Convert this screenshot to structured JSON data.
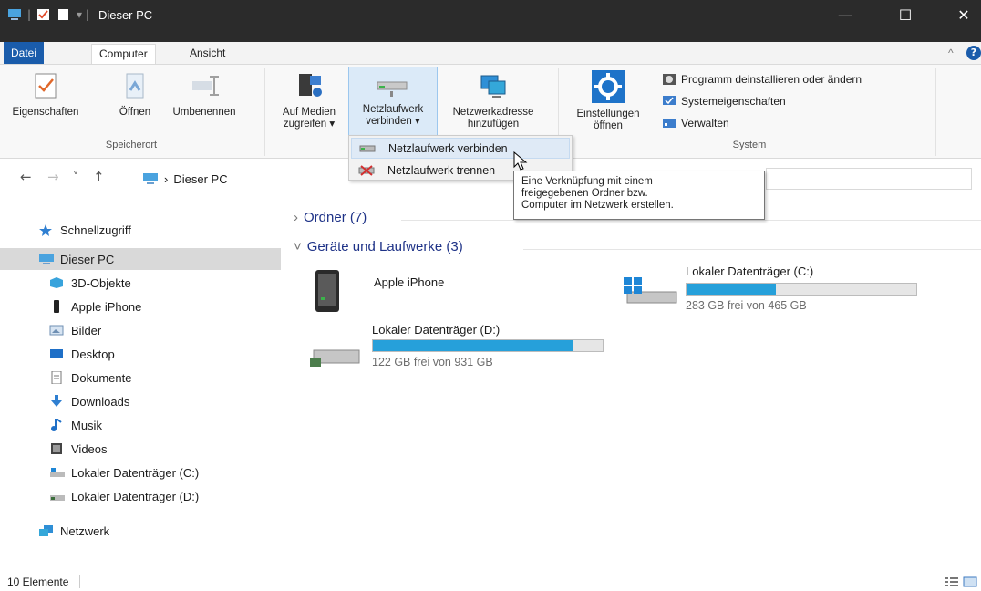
{
  "window": {
    "title": "Dieser PC",
    "minimize_glyph": "—",
    "maximize_glyph": "☐",
    "close_glyph": "✕"
  },
  "tabs": {
    "file": "Datei",
    "computer": "Computer",
    "view": "Ansicht",
    "collapse_glyph": "^",
    "help_glyph": "?"
  },
  "ribbon": {
    "location": {
      "label": "Speicherort",
      "properties": "Eigenschaften",
      "open": "Öffnen",
      "rename": "Umbenennen"
    },
    "network": {
      "media_line1": "Auf Medien",
      "media_line2": "zugreifen ▾",
      "map_drive_line1": "Netzlaufwerk",
      "map_drive_line2": "verbinden ▾",
      "add_location_line1": "Netzwerkadresse",
      "add_location_line2": "hinzufügen"
    },
    "system": {
      "label": "System",
      "settings_line1": "Einstellungen",
      "settings_line2": "öffnen",
      "uninstall": "Programm deinstallieren oder ändern",
      "properties": "Systemeigenschaften",
      "manage": "Verwalten"
    }
  },
  "dropdown": {
    "connect": "Netzlaufwerk verbinden",
    "disconnect": "Netzlaufwerk trennen"
  },
  "tooltip": {
    "line1": "Eine Verknüpfung mit einem",
    "line2": "freigegebenen Ordner bzw.",
    "line3": "Computer im Netzwerk erstellen."
  },
  "address": {
    "back": "←",
    "forward": "→",
    "recent": "˅",
    "up": "↑",
    "separator": "›",
    "path": "Dieser PC"
  },
  "sidebar": {
    "quick_access": "Schnellzugriff",
    "this_pc": "Dieser PC",
    "items": [
      {
        "label": "3D-Objekte",
        "icon": "cube-icon"
      },
      {
        "label": "Apple iPhone",
        "icon": "phone-icon"
      },
      {
        "label": "Bilder",
        "icon": "pictures-icon"
      },
      {
        "label": "Desktop",
        "icon": "desktop-icon"
      },
      {
        "label": "Dokumente",
        "icon": "document-icon"
      },
      {
        "label": "Downloads",
        "icon": "download-icon"
      },
      {
        "label": "Musik",
        "icon": "music-icon"
      },
      {
        "label": "Videos",
        "icon": "video-icon"
      },
      {
        "label": "Lokaler Datenträger (C:)",
        "icon": "drive-c-icon"
      },
      {
        "label": "Lokaler Datenträger (D:)",
        "icon": "drive-d-icon"
      }
    ],
    "network": "Netzwerk"
  },
  "main": {
    "folders_group": "Ordner (7)",
    "devices_group": "Geräte und Laufwerke (3)",
    "collapsed_glyph": "›",
    "expanded_glyph": "˅",
    "devices": [
      {
        "name": "Apple iPhone"
      },
      {
        "name": "Lokaler Datenträger (C:)",
        "free_text": "283 GB frei von 465 GB",
        "used_fraction": 0.39
      },
      {
        "name": "Lokaler Datenträger (D:)",
        "free_text": "122 GB frei von 931 GB",
        "used_fraction": 0.87
      }
    ]
  },
  "status": {
    "count": "10 Elemente"
  },
  "colors": {
    "titlebar": "#2b2b2b",
    "file_tab": "#1a5cab",
    "usage_bar": "#26a0da",
    "selection": "#d9d9d9"
  }
}
